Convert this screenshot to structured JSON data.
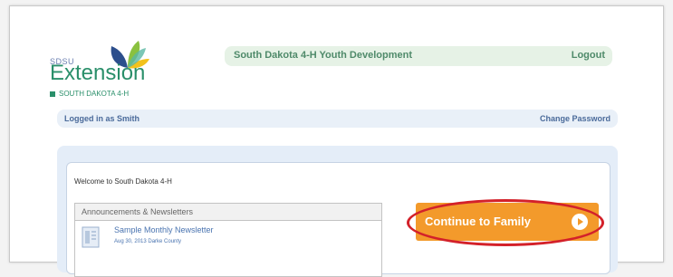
{
  "logo": {
    "top_text": "SDSU",
    "main_text": "Extension",
    "sub_text": "SOUTH DAKOTA 4-H"
  },
  "header": {
    "title": "South Dakota 4-H Youth Development",
    "logout_label": "Logout"
  },
  "userbar": {
    "logged_in_text": "Logged in as Smith",
    "change_password_label": "Change Password"
  },
  "main": {
    "welcome_text": "Welcome to South Dakota 4-H",
    "announcements": {
      "header": "Announcements & Newsletters",
      "items": [
        {
          "title": "Sample Monthly Newsletter",
          "meta": "Aug 30, 2013 Darke County"
        }
      ]
    },
    "continue_button_label": "Continue to Family"
  },
  "colors": {
    "accent_orange": "#f39a2b",
    "highlight_red": "#d3212a",
    "header_green": "#e6f2e6",
    "userbar_blue": "#e9f0f8"
  }
}
